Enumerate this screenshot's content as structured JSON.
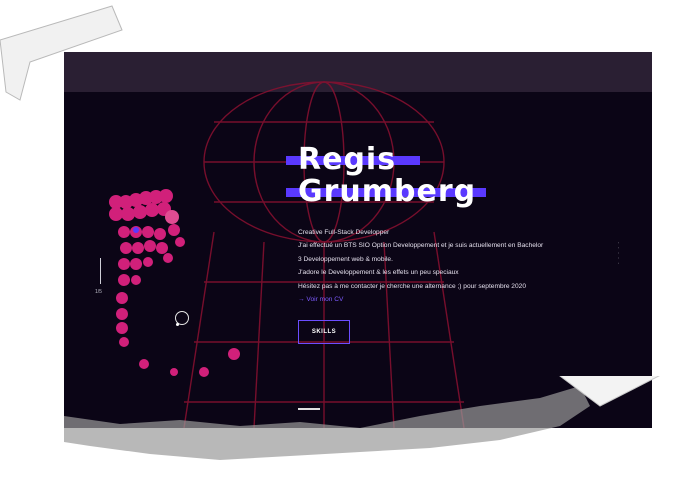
{
  "hero": {
    "name_line1": "Regis",
    "name_line2": "Grumberg",
    "bio_lines": [
      "Creative Full-Stack Developper",
      "J'ai effectué un BTS SIO Option Developpement et je suis actuellement en Bachelor",
      "3 Developpement web & mobile.",
      "J'adore le Developpement & les effets un peu speciaux",
      "Hésitez pas à me contacter je cherche une alternance ;) pour septembre 2020"
    ],
    "cv_link": "→ Voir mon CV",
    "skills_label": "SKILLS"
  },
  "sidebar": {
    "counter": "1/5"
  },
  "colors": {
    "background": "#0b0516",
    "accent_bar": "#5a39ff",
    "grid": "#8a1030",
    "dots": "#d1207a"
  },
  "icons": {
    "ring": "circle-ring-icon"
  }
}
